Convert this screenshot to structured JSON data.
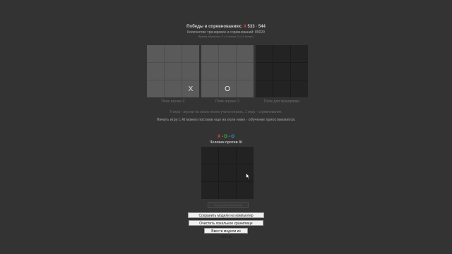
{
  "score": {
    "label": "Победы в соревнованиях:",
    "x_mark": "X",
    "x_value": "533",
    "separator": " - ",
    "o_value": "544"
  },
  "training_count": "Количество тренировок и соревнований: 89029",
  "timer": "Время обучения: 0 ч 0 минут 0 с (4 минут)",
  "boards": {
    "player_x": {
      "caption": "Поле игрока X",
      "cells": [
        "",
        "",
        "",
        "",
        "",
        "",
        "",
        "",
        "X"
      ]
    },
    "player_o": {
      "caption": "Поле игрока O",
      "cells": [
        "",
        "",
        "",
        "",
        "",
        "",
        "",
        "O",
        ""
      ]
    },
    "training": {
      "caption": "Поле для тренировки",
      "cells": [
        "",
        "",
        "",
        "",
        "",
        "",
        "",
        "",
        ""
      ]
    }
  },
  "info": {
    "line1": "X игра - игроки на своих полях учатся играть, 1 игра - соревнование.",
    "line2": "Начать игру с AI можно постами еще на поле ниже - обучение приостановится."
  },
  "legend": {
    "x": "X",
    "sep1": " - ",
    "draw": "D",
    "sep2": " - ",
    "o": "O"
  },
  "vs_ai": {
    "title": "Человек против AI",
    "cells": [
      "",
      "",
      "",
      "",
      "",
      "",
      "",
      "",
      ""
    ],
    "status": "Ход игрока (кликните)"
  },
  "buttons": {
    "save": "Сохранить модели на компьютер",
    "clear": "Очистить локальное хранилище",
    "github": "Ввести модели из GitHub"
  },
  "colors": {
    "background": "#333333",
    "x_color": "#e84c3d",
    "o_color": "#2e9be0",
    "draw_color": "#3fb950"
  }
}
